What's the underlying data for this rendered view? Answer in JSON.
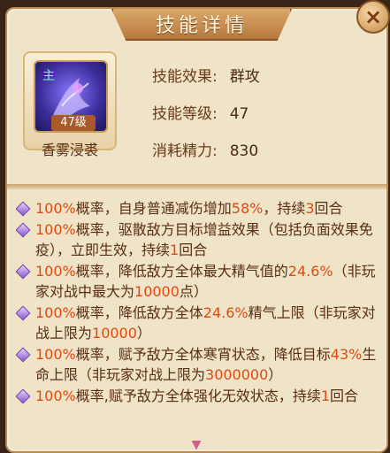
{
  "title": "技能详情",
  "close_icon": "×",
  "skill": {
    "name": "香雾浸裘",
    "level_badge": "47级",
    "stats": [
      {
        "label": "技能效果:",
        "value": "群攻"
      },
      {
        "label": "技能等级:",
        "value": "47"
      },
      {
        "label": "消耗精力:",
        "value": "830"
      }
    ]
  },
  "effects": [
    {
      "parts": [
        {
          "t": "100%",
          "hl": true
        },
        {
          "t": "概率，自身普通减伤增加"
        },
        {
          "t": "58%",
          "hl": true
        },
        {
          "t": "，持续"
        },
        {
          "t": "3",
          "hl": true
        },
        {
          "t": "回合"
        }
      ]
    },
    {
      "parts": [
        {
          "t": "100%",
          "hl": true
        },
        {
          "t": "概率，驱散敌方目标增益效果（包括负面效果免疫），立即生效，持续"
        },
        {
          "t": "1",
          "hl": true
        },
        {
          "t": "回合"
        }
      ]
    },
    {
      "parts": [
        {
          "t": "100%",
          "hl": true
        },
        {
          "t": "概率，降低敌方全体最大精气值的"
        },
        {
          "t": "24.6%",
          "hl": true
        },
        {
          "t": "（非玩家对战中最大为"
        },
        {
          "t": "10000",
          "hl": true
        },
        {
          "t": "点）"
        }
      ]
    },
    {
      "parts": [
        {
          "t": "100%",
          "hl": true
        },
        {
          "t": "概率，降低敌方全体"
        },
        {
          "t": "24.6%",
          "hl": true
        },
        {
          "t": "精气上限（非玩家对战上限为"
        },
        {
          "t": "10000",
          "hl": true
        },
        {
          "t": "）"
        }
      ]
    },
    {
      "parts": [
        {
          "t": "100%",
          "hl": true
        },
        {
          "t": "概率，赋予敌方全体寒宵状态，降低目标"
        },
        {
          "t": "43%",
          "hl": true
        },
        {
          "t": "生命上限（非玩家对战上限为"
        },
        {
          "t": "3000000",
          "hl": true
        },
        {
          "t": "）"
        }
      ]
    },
    {
      "parts": [
        {
          "t": "100%",
          "hl": true
        },
        {
          "t": "概率,赋予敌方全体强化无效状态，持续"
        },
        {
          "t": "1",
          "hl": true
        },
        {
          "t": "回合"
        }
      ]
    }
  ]
}
